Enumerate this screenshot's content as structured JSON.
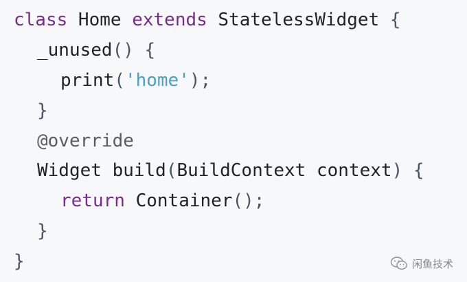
{
  "code": {
    "l1": {
      "k1": "class",
      "t1": " Home ",
      "k2": "extends",
      "t2": " StatelessWidget ",
      "p1": "{"
    },
    "l2": {
      "t1": "_unused",
      "p1": "()",
      "t2": " ",
      "p2": "{"
    },
    "l3": {
      "t1": "print",
      "p1": "(",
      "s1": "'home'",
      "p2": ");"
    },
    "l4": {
      "p1": "}"
    },
    "l5": {
      "a1": "@override"
    },
    "l6": {
      "t1": "Widget build",
      "p1": "(",
      "t2": "BuildContext context",
      "p2": ")",
      "t3": " ",
      "p3": "{"
    },
    "l7": {
      "k1": "return",
      "t1": " Container",
      "p1": "();"
    },
    "l8": {
      "p1": "}"
    },
    "l9": {
      "p1": "}"
    }
  },
  "watermark": {
    "icon": "wechat-icon",
    "text": "闲鱼技术"
  },
  "colors": {
    "keyword": "#7a2b8f",
    "string": "#4a9fc4",
    "punctuation": "#4a5563",
    "background": "#f6f8fa"
  }
}
